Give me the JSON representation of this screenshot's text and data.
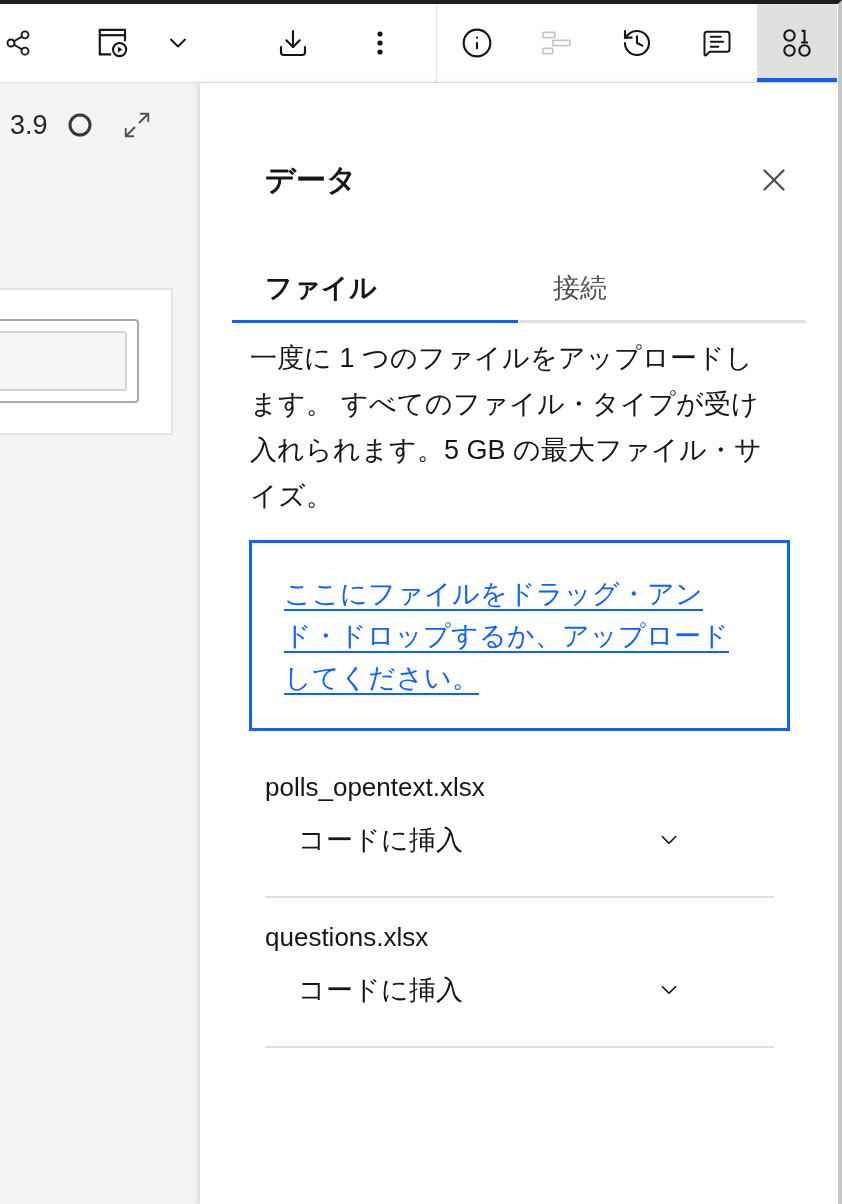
{
  "toolbar": {
    "actions": [
      {
        "kind": "share"
      },
      {
        "kind": "run"
      },
      {
        "kind": "chevron"
      },
      {
        "kind": "download"
      },
      {
        "kind": "overflow"
      }
    ],
    "panel_toggles": [
      {
        "kind": "info",
        "selected": false,
        "disabled": false
      },
      {
        "kind": "outline",
        "selected": false,
        "disabled": true
      },
      {
        "kind": "history",
        "selected": false,
        "disabled": false
      },
      {
        "kind": "comments",
        "selected": false,
        "disabled": false
      },
      {
        "kind": "data",
        "selected": true,
        "disabled": false
      }
    ]
  },
  "notebook": {
    "kernel_version": "3.9"
  },
  "panel": {
    "title": "データ",
    "tabs": [
      {
        "label": "ファイル",
        "selected": true
      },
      {
        "label": "接続",
        "selected": false
      }
    ],
    "description": "一度に 1 つのファイルをアップロードします。 すべてのファイル・タイプが受け入れられます。5 GB の最大ファイル・サイズ。",
    "drop_zone": {
      "link": "ここにファイルをドラッグ・アンド・ドロップするか、アップロードしてください。"
    },
    "files": [
      {
        "name": "polls_opentext.xlsx",
        "action": "コードに挿入"
      },
      {
        "name": "questions.xlsx",
        "action": "コードに挿入"
      }
    ]
  }
}
